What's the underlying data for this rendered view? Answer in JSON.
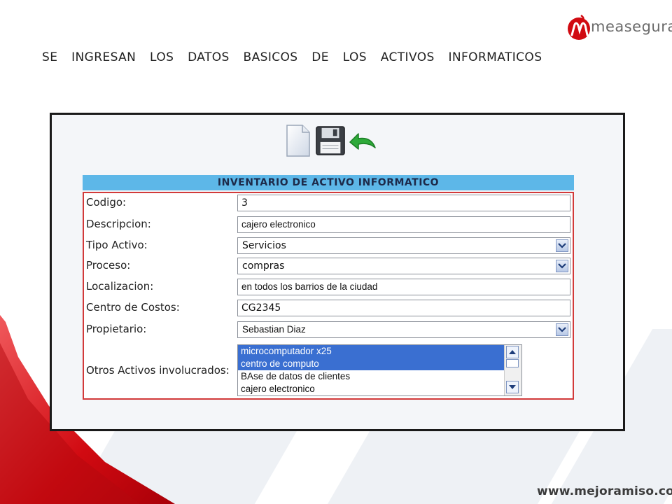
{
  "slide": {
    "heading": "SE INGRESAN LOS DATOS BASICOS DE LOS ACTIVOS INFORMATICOS",
    "logo_text": "measegura",
    "footer_url": "www.mejoramiso.com",
    "accent_red": "#d10a11"
  },
  "toolbar": {
    "items": [
      {
        "name": "new-document-icon"
      },
      {
        "name": "save-floppy-icon"
      },
      {
        "name": "undo-arrow-icon"
      }
    ]
  },
  "form": {
    "title": "INVENTARIO DE ACTIVO INFORMATICO",
    "fields": {
      "codigo": {
        "label": "Codigo:",
        "value": "3"
      },
      "descripcion": {
        "label": "Descripcion:",
        "value": "cajero electronico"
      },
      "tipo_activo": {
        "label": "Tipo Activo:",
        "value": "Servicios"
      },
      "proceso": {
        "label": "Proceso:",
        "value": "compras"
      },
      "localizacion": {
        "label": "Localizacion:",
        "value": "en todos los barrios de la ciudad"
      },
      "centro_costos": {
        "label": "Centro de Costos:",
        "value": "CG2345"
      },
      "propietario": {
        "label": "Propietario:",
        "value": "Sebastian Diaz"
      }
    },
    "otros_activos": {
      "label": "Otros Activos involucrados:",
      "options": [
        {
          "label": "microcomputador x25",
          "selected": true
        },
        {
          "label": "centro de computo",
          "selected": true
        },
        {
          "label": "BAse de datos de clientes",
          "selected": false
        },
        {
          "label": "cajero electronico",
          "selected": false
        }
      ]
    }
  }
}
